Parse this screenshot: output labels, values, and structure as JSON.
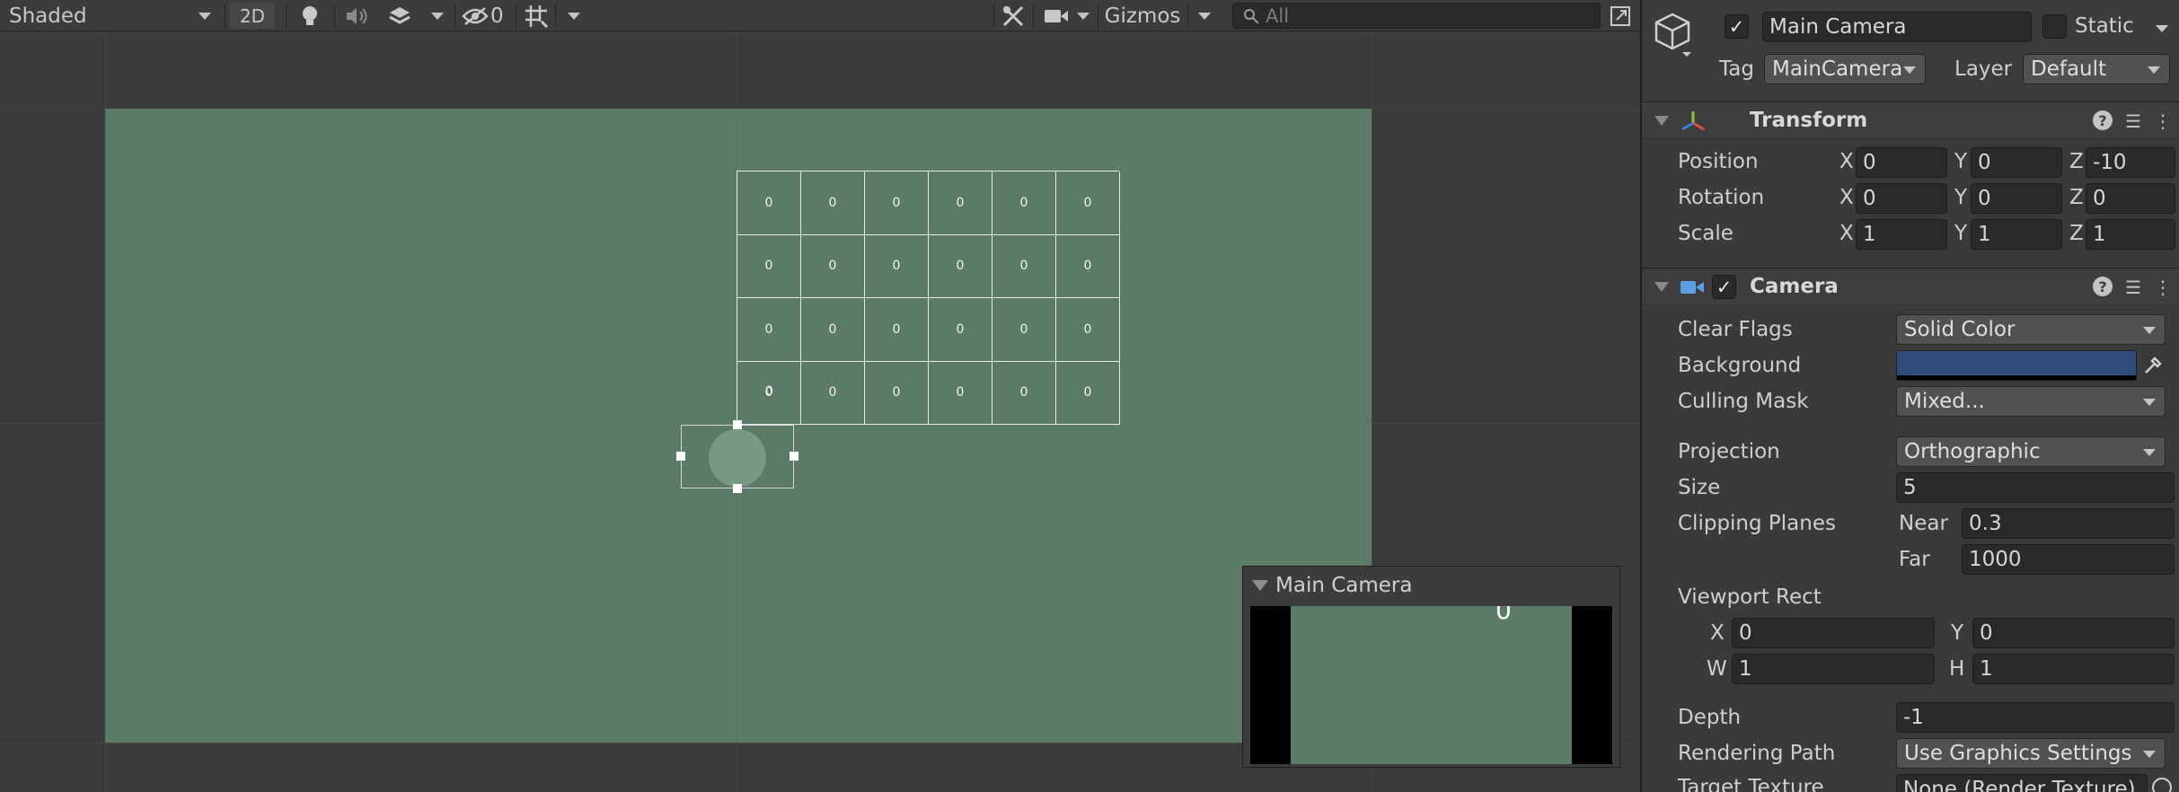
{
  "scene_toolbar": {
    "shading_mode": "Shaded",
    "toggle_2d": "2D",
    "hidden_count": "0",
    "gizmos_label": "Gizmos",
    "search_placeholder": "All"
  },
  "grid": {
    "rows": [
      [
        "0",
        "0",
        "0",
        "0",
        "0",
        "0"
      ],
      [
        "0",
        "0",
        "0",
        "0",
        "0",
        "0"
      ],
      [
        "0",
        "0",
        "0",
        "0",
        "0",
        "0"
      ],
      [
        "0",
        "0",
        "0",
        "0",
        "0",
        "0"
      ]
    ]
  },
  "selected_object_label": "0",
  "camera_preview": {
    "title": "Main Camera",
    "overlay_text": "0"
  },
  "inspector": {
    "object_name": "Main Camera",
    "active": true,
    "static_label": "Static",
    "tag_label": "Tag",
    "tag_value": "MainCamera",
    "layer_label": "Layer",
    "layer_value": "Default",
    "transform": {
      "title": "Transform",
      "position_label": "Position",
      "rotation_label": "Rotation",
      "scale_label": "Scale",
      "position": {
        "x": "0",
        "y": "0",
        "z": "-10"
      },
      "rotation": {
        "x": "0",
        "y": "0",
        "z": "0"
      },
      "scale": {
        "x": "1",
        "y": "1",
        "z": "1"
      },
      "axis_x": "X",
      "axis_y": "Y",
      "axis_z": "Z"
    },
    "camera": {
      "title": "Camera",
      "enabled": true,
      "clear_flags_label": "Clear Flags",
      "clear_flags_value": "Solid Color",
      "background_label": "Background",
      "background_color": "#314d79",
      "culling_mask_label": "Culling Mask",
      "culling_mask_value": "Mixed...",
      "projection_label": "Projection",
      "projection_value": "Orthographic",
      "size_label": "Size",
      "size_value": "5",
      "clipping_planes_label": "Clipping Planes",
      "near_label": "Near",
      "near_value": "0.3",
      "far_label": "Far",
      "far_value": "1000",
      "viewport_rect_label": "Viewport Rect",
      "viewport": {
        "x": "0",
        "y": "0",
        "w": "1",
        "h": "1"
      },
      "x_label": "X",
      "y_label": "Y",
      "w_label": "W",
      "h_label": "H",
      "depth_label": "Depth",
      "depth_value": "-1",
      "rendering_path_label": "Rendering Path",
      "rendering_path_value": "Use Graphics Settings",
      "target_texture_label": "Target Texture",
      "target_texture_value": "None (Render Texture)"
    }
  },
  "colors": {
    "scene_background": "#3b3b3b",
    "camera_area": "#5b7b67",
    "inspector_background": "#3a3a3a"
  }
}
